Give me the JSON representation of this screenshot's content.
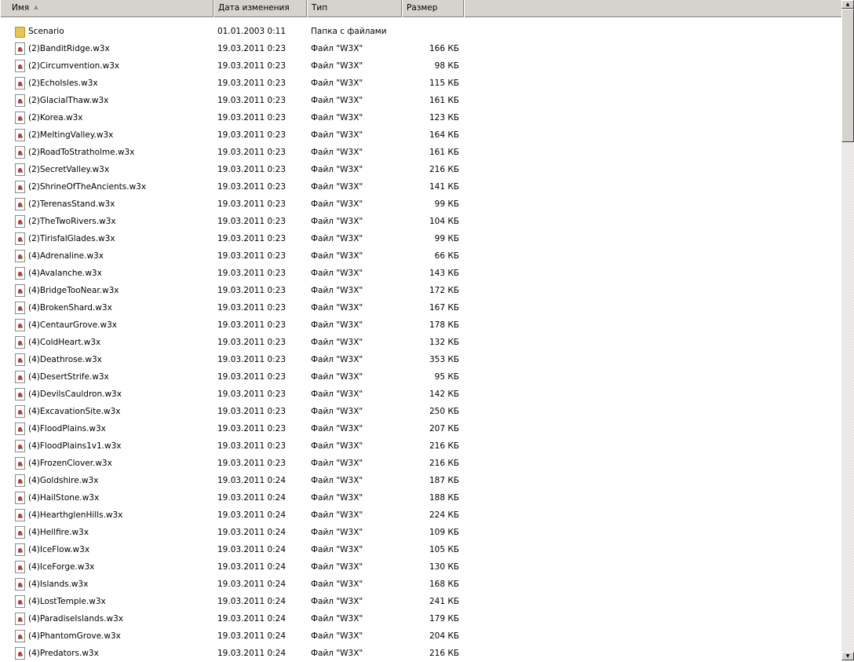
{
  "columns": {
    "name": "Имя",
    "date": "Дата изменения",
    "type": "Тип",
    "size": "Размер"
  },
  "sort_indicator": "▲",
  "items": [
    {
      "name": "Scenario",
      "date": "01.01.2003 0:11",
      "type": "Папка с файлами",
      "size": "",
      "kind": "folder"
    },
    {
      "name": "(2)BanditRidge.w3x",
      "date": "19.03.2011 0:23",
      "type": "Файл \"W3X\"",
      "size": "166 КБ",
      "kind": "file"
    },
    {
      "name": "(2)Circumvention.w3x",
      "date": "19.03.2011 0:23",
      "type": "Файл \"W3X\"",
      "size": "98 КБ",
      "kind": "file"
    },
    {
      "name": "(2)EchoIsles.w3x",
      "date": "19.03.2011 0:23",
      "type": "Файл \"W3X\"",
      "size": "115 КБ",
      "kind": "file"
    },
    {
      "name": "(2)GlacialThaw.w3x",
      "date": "19.03.2011 0:23",
      "type": "Файл \"W3X\"",
      "size": "161 КБ",
      "kind": "file"
    },
    {
      "name": "(2)Korea.w3x",
      "date": "19.03.2011 0:23",
      "type": "Файл \"W3X\"",
      "size": "123 КБ",
      "kind": "file"
    },
    {
      "name": "(2)MeltingValley.w3x",
      "date": "19.03.2011 0:23",
      "type": "Файл \"W3X\"",
      "size": "164 КБ",
      "kind": "file"
    },
    {
      "name": "(2)RoadToStratholme.w3x",
      "date": "19.03.2011 0:23",
      "type": "Файл \"W3X\"",
      "size": "161 КБ",
      "kind": "file"
    },
    {
      "name": "(2)SecretValley.w3x",
      "date": "19.03.2011 0:23",
      "type": "Файл \"W3X\"",
      "size": "216 КБ",
      "kind": "file"
    },
    {
      "name": "(2)ShrineOfTheAncients.w3x",
      "date": "19.03.2011 0:23",
      "type": "Файл \"W3X\"",
      "size": "141 КБ",
      "kind": "file"
    },
    {
      "name": "(2)TerenasStand.w3x",
      "date": "19.03.2011 0:23",
      "type": "Файл \"W3X\"",
      "size": "99 КБ",
      "kind": "file"
    },
    {
      "name": "(2)TheTwoRivers.w3x",
      "date": "19.03.2011 0:23",
      "type": "Файл \"W3X\"",
      "size": "104 КБ",
      "kind": "file"
    },
    {
      "name": "(2)TirisfalGlades.w3x",
      "date": "19.03.2011 0:23",
      "type": "Файл \"W3X\"",
      "size": "99 КБ",
      "kind": "file"
    },
    {
      "name": "(4)Adrenaline.w3x",
      "date": "19.03.2011 0:23",
      "type": "Файл \"W3X\"",
      "size": "66 КБ",
      "kind": "file"
    },
    {
      "name": "(4)Avalanche.w3x",
      "date": "19.03.2011 0:23",
      "type": "Файл \"W3X\"",
      "size": "143 КБ",
      "kind": "file"
    },
    {
      "name": "(4)BridgeTooNear.w3x",
      "date": "19.03.2011 0:23",
      "type": "Файл \"W3X\"",
      "size": "172 КБ",
      "kind": "file"
    },
    {
      "name": "(4)BrokenShard.w3x",
      "date": "19.03.2011 0:23",
      "type": "Файл \"W3X\"",
      "size": "167 КБ",
      "kind": "file"
    },
    {
      "name": "(4)CentaurGrove.w3x",
      "date": "19.03.2011 0:23",
      "type": "Файл \"W3X\"",
      "size": "178 КБ",
      "kind": "file"
    },
    {
      "name": "(4)ColdHeart.w3x",
      "date": "19.03.2011 0:23",
      "type": "Файл \"W3X\"",
      "size": "132 КБ",
      "kind": "file"
    },
    {
      "name": "(4)Deathrose.w3x",
      "date": "19.03.2011 0:23",
      "type": "Файл \"W3X\"",
      "size": "353 КБ",
      "kind": "file"
    },
    {
      "name": "(4)DesertStrife.w3x",
      "date": "19.03.2011 0:23",
      "type": "Файл \"W3X\"",
      "size": "95 КБ",
      "kind": "file"
    },
    {
      "name": "(4)DevilsCauldron.w3x",
      "date": "19.03.2011 0:23",
      "type": "Файл \"W3X\"",
      "size": "142 КБ",
      "kind": "file"
    },
    {
      "name": "(4)ExcavationSite.w3x",
      "date": "19.03.2011 0:23",
      "type": "Файл \"W3X\"",
      "size": "250 КБ",
      "kind": "file"
    },
    {
      "name": "(4)FloodPlains.w3x",
      "date": "19.03.2011 0:23",
      "type": "Файл \"W3X\"",
      "size": "207 КБ",
      "kind": "file"
    },
    {
      "name": "(4)FloodPlains1v1.w3x",
      "date": "19.03.2011 0:23",
      "type": "Файл \"W3X\"",
      "size": "216 КБ",
      "kind": "file"
    },
    {
      "name": "(4)FrozenClover.w3x",
      "date": "19.03.2011 0:23",
      "type": "Файл \"W3X\"",
      "size": "216 КБ",
      "kind": "file"
    },
    {
      "name": "(4)Goldshire.w3x",
      "date": "19.03.2011 0:24",
      "type": "Файл \"W3X\"",
      "size": "187 КБ",
      "kind": "file"
    },
    {
      "name": "(4)HailStone.w3x",
      "date": "19.03.2011 0:24",
      "type": "Файл \"W3X\"",
      "size": "188 КБ",
      "kind": "file"
    },
    {
      "name": "(4)HearthglenHills.w3x",
      "date": "19.03.2011 0:24",
      "type": "Файл \"W3X\"",
      "size": "224 КБ",
      "kind": "file"
    },
    {
      "name": "(4)Hellfire.w3x",
      "date": "19.03.2011 0:24",
      "type": "Файл \"W3X\"",
      "size": "109 КБ",
      "kind": "file"
    },
    {
      "name": "(4)IceFlow.w3x",
      "date": "19.03.2011 0:24",
      "type": "Файл \"W3X\"",
      "size": "105 КБ",
      "kind": "file"
    },
    {
      "name": "(4)IceForge.w3x",
      "date": "19.03.2011 0:24",
      "type": "Файл \"W3X\"",
      "size": "130 КБ",
      "kind": "file"
    },
    {
      "name": "(4)Islands.w3x",
      "date": "19.03.2011 0:24",
      "type": "Файл \"W3X\"",
      "size": "168 КБ",
      "kind": "file"
    },
    {
      "name": "(4)LostTemple.w3x",
      "date": "19.03.2011 0:24",
      "type": "Файл \"W3X\"",
      "size": "241 КБ",
      "kind": "file"
    },
    {
      "name": "(4)ParadiseIslands.w3x",
      "date": "19.03.2011 0:24",
      "type": "Файл \"W3X\"",
      "size": "179 КБ",
      "kind": "file"
    },
    {
      "name": "(4)PhantomGrove.w3x",
      "date": "19.03.2011 0:24",
      "type": "Файл \"W3X\"",
      "size": "204 КБ",
      "kind": "file"
    },
    {
      "name": "(4)Predators.w3x",
      "date": "19.03.2011 0:24",
      "type": "Файл \"W3X\"",
      "size": "216 КБ",
      "kind": "file"
    }
  ]
}
